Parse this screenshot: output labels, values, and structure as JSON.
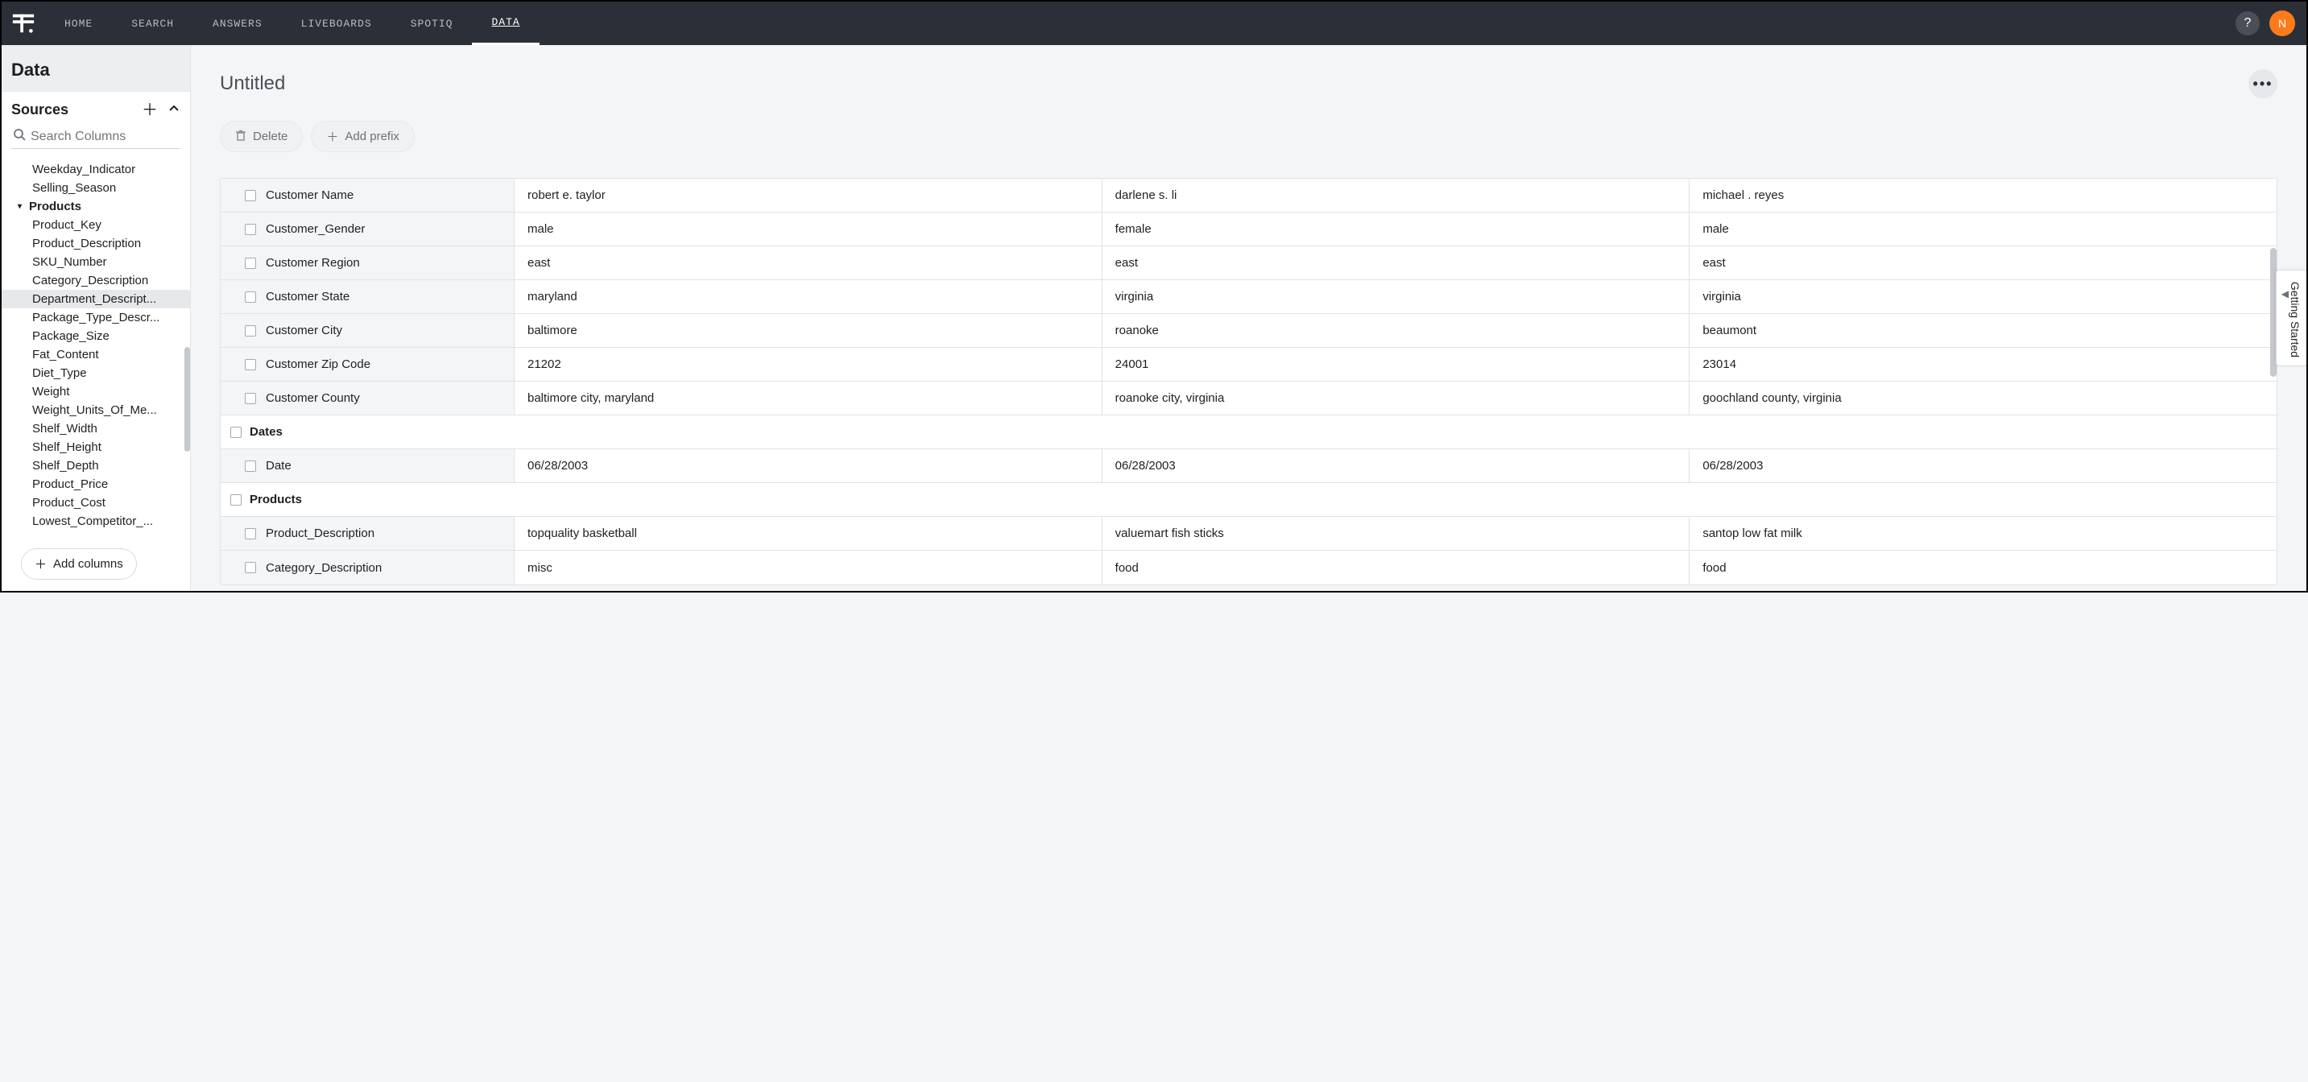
{
  "nav": {
    "items": [
      "HOME",
      "SEARCH",
      "ANSWERS",
      "LIVEBOARDS",
      "SPOTIQ",
      "DATA"
    ],
    "active_index": 5,
    "help_glyph": "?",
    "avatar_initial": "N"
  },
  "sidebar": {
    "title": "Data",
    "sources_label": "Sources",
    "search_placeholder": "Search Columns",
    "add_columns_label": "Add columns",
    "tree": [
      {
        "type": "item",
        "label": "Weekday_Indicator"
      },
      {
        "type": "item",
        "label": "Selling_Season"
      },
      {
        "type": "group",
        "label": "Products"
      },
      {
        "type": "item",
        "label": "Product_Key"
      },
      {
        "type": "item",
        "label": "Product_Description"
      },
      {
        "type": "item",
        "label": "SKU_Number"
      },
      {
        "type": "item",
        "label": "Category_Description"
      },
      {
        "type": "item",
        "label": "Department_Descript...",
        "selected": true
      },
      {
        "type": "item",
        "label": "Package_Type_Descr..."
      },
      {
        "type": "item",
        "label": "Package_Size"
      },
      {
        "type": "item",
        "label": "Fat_Content"
      },
      {
        "type": "item",
        "label": "Diet_Type"
      },
      {
        "type": "item",
        "label": "Weight"
      },
      {
        "type": "item",
        "label": "Weight_Units_Of_Me..."
      },
      {
        "type": "item",
        "label": "Shelf_Width"
      },
      {
        "type": "item",
        "label": "Shelf_Height"
      },
      {
        "type": "item",
        "label": "Shelf_Depth"
      },
      {
        "type": "item",
        "label": "Product_Price"
      },
      {
        "type": "item",
        "label": "Product_Cost"
      },
      {
        "type": "item",
        "label": "Lowest_Competitor_..."
      }
    ]
  },
  "main": {
    "title": "Untitled",
    "delete_label": "Delete",
    "add_prefix_label": "Add prefix",
    "getting_started_label": "Getting Started"
  },
  "table": {
    "rows": [
      {
        "type": "data",
        "label": "Customer Name",
        "v1": "robert e. taylor",
        "v2": "darlene s. li",
        "v3": "michael . reyes"
      },
      {
        "type": "data",
        "label": "Customer_Gender",
        "v1": "male",
        "v2": "female",
        "v3": "male"
      },
      {
        "type": "data",
        "label": "Customer Region",
        "v1": "east",
        "v2": "east",
        "v3": "east"
      },
      {
        "type": "data",
        "label": "Customer State",
        "v1": "maryland",
        "v2": "virginia",
        "v3": "virginia"
      },
      {
        "type": "data",
        "label": "Customer City",
        "v1": "baltimore",
        "v2": "roanoke",
        "v3": "beaumont"
      },
      {
        "type": "data",
        "label": "Customer Zip Code",
        "v1": "21202",
        "v2": "24001",
        "v3": "23014"
      },
      {
        "type": "data",
        "label": "Customer County",
        "v1": "baltimore city, maryland",
        "v2": "roanoke city, virginia",
        "v3": "goochland county, virginia"
      },
      {
        "type": "section",
        "label": "Dates"
      },
      {
        "type": "data",
        "label": "Date",
        "v1": "06/28/2003",
        "v2": "06/28/2003",
        "v3": "06/28/2003"
      },
      {
        "type": "section",
        "label": "Products"
      },
      {
        "type": "data",
        "label": "Product_Description",
        "v1": "topquality basketball",
        "v2": "valuemart fish sticks",
        "v3": "santop low fat milk"
      },
      {
        "type": "data",
        "label": "Category_Description",
        "v1": "misc",
        "v2": "food",
        "v3": "food"
      }
    ]
  }
}
